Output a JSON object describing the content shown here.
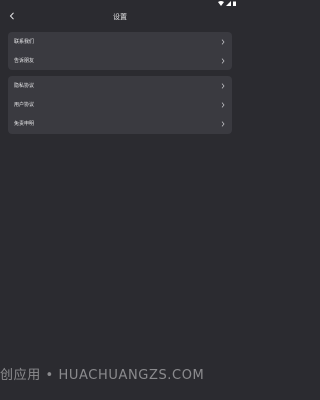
{
  "header": {
    "title": "设置",
    "back_icon": "chevron-left-icon"
  },
  "status_bar": {
    "icons": [
      "wifi-icon",
      "signal-icon",
      "battery-icon"
    ]
  },
  "groups": [
    {
      "items": [
        {
          "label": "联系我们",
          "icon": "chevron-right-icon"
        },
        {
          "label": "告诉朋友",
          "icon": "chevron-right-icon"
        }
      ]
    },
    {
      "items": [
        {
          "label": "隐私协议",
          "icon": "chevron-right-icon"
        },
        {
          "label": "用户协议",
          "icon": "chevron-right-icon"
        },
        {
          "label": "免责申明",
          "icon": "chevron-right-icon"
        }
      ]
    }
  ],
  "watermark": {
    "text": "创应用 • HUACHUANGZS.COM"
  },
  "colors": {
    "background": "#2b2b30",
    "card": "#3a3a40",
    "text": "#e8e8ea"
  }
}
